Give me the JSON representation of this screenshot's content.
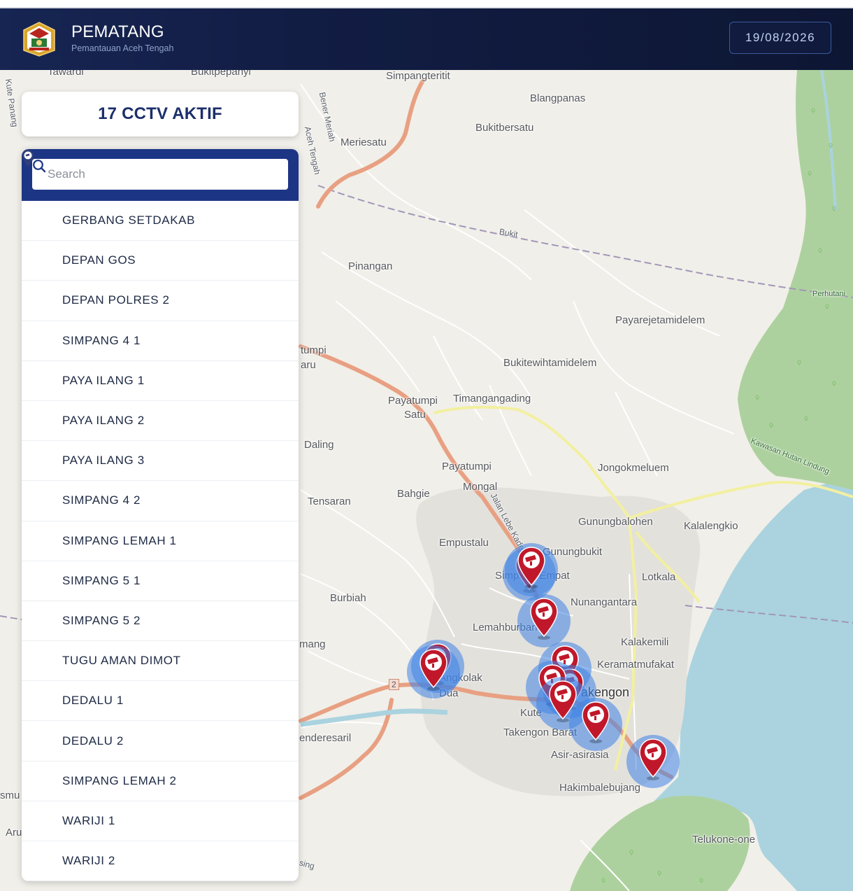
{
  "header": {
    "title": "PEMATANG",
    "subtitle": "Pemantauan Aceh Tengah",
    "date": "19/08/2026"
  },
  "status": {
    "active_count_label": "17 CCTV AKTIF"
  },
  "search": {
    "placeholder": "Search"
  },
  "cameras": [
    {
      "label": "GERBANG SETDAKAB"
    },
    {
      "label": "DEPAN GOS"
    },
    {
      "label": "DEPAN POLRES 2"
    },
    {
      "label": "SIMPANG 4 1"
    },
    {
      "label": "PAYA ILANG 1"
    },
    {
      "label": "PAYA ILANG 2"
    },
    {
      "label": "PAYA ILANG 3"
    },
    {
      "label": "SIMPANG 4 2"
    },
    {
      "label": "SIMPANG LEMAH 1"
    },
    {
      "label": "SIMPANG 5 1"
    },
    {
      "label": "SIMPANG 5 2"
    },
    {
      "label": "TUGU AMAN DIMOT"
    },
    {
      "label": "DEDALU 1"
    },
    {
      "label": "DEDALU 2"
    },
    {
      "label": "SIMPANG LEMAH 2"
    },
    {
      "label": "WARIJI 1"
    },
    {
      "label": "WARIJI 2"
    }
  ],
  "map": {
    "places": [
      "Tawardi",
      "Bukitpepanyi",
      "Simpangteritit",
      "Blangpanas",
      "Bukitbersatu",
      "Meriesatu",
      "Bukit",
      "Pinangan",
      "Payarejetamidelem",
      "Bukitewihtamidelem",
      "Payatumpi",
      "Satu",
      "Timangangading",
      "Daling",
      "Payatumpi",
      "Mongal",
      "Bahgie",
      "Jongokmeluem",
      "Tensaran",
      "Gunungbalohen",
      "Kalalengkio",
      "Empustalu",
      "Gunungbukit",
      "Simpang Empat",
      "Lotkala",
      "Burbiah",
      "Nunangantara",
      "Lemahburbana",
      "Kalakemili",
      "Keramatmufakat",
      "Takengon",
      "Angkolak Dua",
      "Kute",
      "Takengon Barat",
      "Asir-asirasia",
      "Hakimbalebujang",
      "Telukone-one",
      "enderesaril",
      "tumpi",
      "aru",
      "mang",
      "Aru",
      "smu",
      "Kute Panang",
      "Bener Meriah",
      "Aceh Tengah",
      "Jalan Lebe Kader",
      "Perhutani",
      "Kawasan Hutan Lindung",
      "sing",
      "2"
    ],
    "marker_color": "#c0182a",
    "halo_color": "#4083e6",
    "water_color": "#aad3df",
    "forest_color": "#add19e"
  },
  "icons": {
    "list_pin": "map-pin-icon",
    "search": "search-icon",
    "marker": "cctv-marker-icon"
  }
}
